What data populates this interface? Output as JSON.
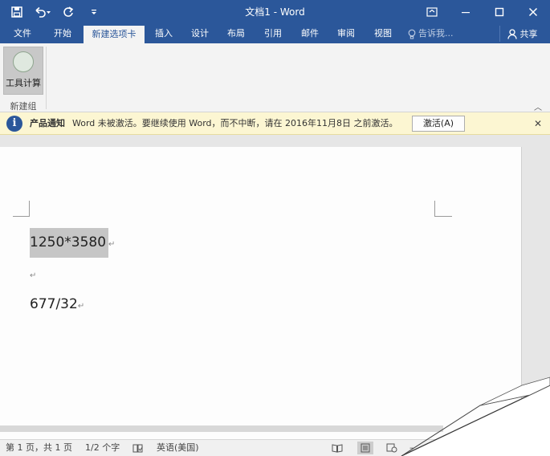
{
  "window": {
    "title": "文档1 - Word"
  },
  "qat": {
    "save_icon": "save-icon",
    "undo_icon": "undo-icon",
    "redo_icon": "redo-icon",
    "customize_icon": "customize-qat-icon"
  },
  "tabs": [
    {
      "label": "文件"
    },
    {
      "label": "开始"
    },
    {
      "label": "新建选项卡",
      "active": true
    },
    {
      "label": "插入"
    },
    {
      "label": "设计"
    },
    {
      "label": "布局"
    },
    {
      "label": "引用"
    },
    {
      "label": "邮件"
    },
    {
      "label": "审阅"
    },
    {
      "label": "视图"
    }
  ],
  "tellme": {
    "placeholder": "告诉我..."
  },
  "share": {
    "label": "共享"
  },
  "ribbon": {
    "button_label": "工具计算",
    "group_label": "新建组"
  },
  "notification": {
    "title": "产品通知",
    "message": "Word 未被激活。要继续使用 Word，而不中断，请在 2016年11月8日 之前激活。",
    "button_label": "激活(A)"
  },
  "document": {
    "line1": "1250*3580",
    "paragraph_mark": "↵",
    "line3": "677/32"
  },
  "status": {
    "page": "第 1 页，共 1 页",
    "words": "1/2 个字",
    "language": "英语(美国)"
  },
  "colors": {
    "accent": "#2b579a",
    "notification_bg": "#fcf6d2"
  }
}
